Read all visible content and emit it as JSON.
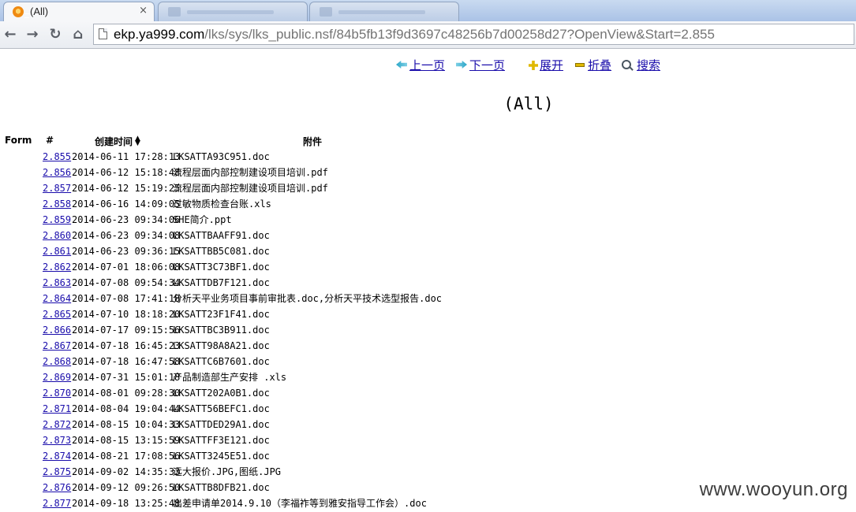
{
  "browser": {
    "tabs": [
      {
        "title": "(All)",
        "close": "×",
        "active": true
      },
      {
        "title": "",
        "active": false
      },
      {
        "title": "",
        "active": false
      }
    ],
    "nav": {
      "back": "←",
      "forward": "→",
      "reload": "↻",
      "home": "⌂"
    },
    "url": {
      "host": "ekp.ya999.com",
      "path": "/lks/sys/lks_public.nsf/84b5fb13f9d3697c48256b7d00258d27?OpenView&Start=2.855"
    }
  },
  "page": {
    "nav_links": {
      "prev": "上一页",
      "next": "下一页",
      "expand": "展开",
      "collapse": "折叠",
      "search": "搜索"
    },
    "view_title": "(All)",
    "columns": {
      "form": "Form",
      "num": "#",
      "created": "创建时间",
      "attachment": "附件"
    },
    "rows": [
      {
        "num": "2.855",
        "datetime": "2014-06-11 17:28:13",
        "file": "LKSATTA93C951.doc"
      },
      {
        "num": "2.856",
        "datetime": "2014-06-12 15:18:48",
        "file": "流程层面内部控制建设项目培训.pdf"
      },
      {
        "num": "2.857",
        "datetime": "2014-06-12 15:19:25",
        "file": "流程层面内部控制建设项目培训.pdf"
      },
      {
        "num": "2.858",
        "datetime": "2014-06-16 14:09:05",
        "file": "过敏物质检查台账.xls"
      },
      {
        "num": "2.859",
        "datetime": "2014-06-23 09:34:06",
        "file": "SHE简介.ppt"
      },
      {
        "num": "2.860",
        "datetime": "2014-06-23 09:34:08",
        "file": "LKSATTBAAFF91.doc"
      },
      {
        "num": "2.861",
        "datetime": "2014-06-23 09:36:15",
        "file": "LKSATTBB5C081.doc"
      },
      {
        "num": "2.862",
        "datetime": "2014-07-01 18:06:08",
        "file": "LKSATT3C73BF1.doc"
      },
      {
        "num": "2.863",
        "datetime": "2014-07-08 09:54:34",
        "file": "LKSATTDB7F121.doc"
      },
      {
        "num": "2.864",
        "datetime": "2014-07-08 17:41:18",
        "file": "分析天平业务项目事前审批表.doc,分析天平技术选型报告.doc"
      },
      {
        "num": "2.865",
        "datetime": "2014-07-10 18:18:20",
        "file": "LKSATT23F1F41.doc"
      },
      {
        "num": "2.866",
        "datetime": "2014-07-17 09:15:56",
        "file": "LKSATTBC3B911.doc"
      },
      {
        "num": "2.867",
        "datetime": "2014-07-18 16:45:23",
        "file": "LKSATT98A8A21.doc"
      },
      {
        "num": "2.868",
        "datetime": "2014-07-18 16:47:58",
        "file": "LKSATTC6B7601.doc"
      },
      {
        "num": "2.869",
        "datetime": "2014-07-31 15:01:18",
        "file": "产品制造部生产安排 .xls"
      },
      {
        "num": "2.870",
        "datetime": "2014-08-01 09:28:30",
        "file": "LKSATT202A0B1.doc"
      },
      {
        "num": "2.871",
        "datetime": "2014-08-04 19:04:44",
        "file": "LKSATT56BEFC1.doc"
      },
      {
        "num": "2.872",
        "datetime": "2014-08-15 10:04:33",
        "file": "LKSATTDED29A1.doc"
      },
      {
        "num": "2.873",
        "datetime": "2014-08-15 13:15:59",
        "file": "LKSATTFF3E121.doc"
      },
      {
        "num": "2.874",
        "datetime": "2014-08-21 17:08:56",
        "file": "LKSATT3245E51.doc"
      },
      {
        "num": "2.875",
        "datetime": "2014-09-02 14:35:33",
        "file": "远大报价.JPG,图纸.JPG"
      },
      {
        "num": "2.876",
        "datetime": "2014-09-12 09:26:50",
        "file": "LKSATTB8DFB21.doc"
      },
      {
        "num": "2.877",
        "datetime": "2014-09-18 13:25:48",
        "file": "出差申请单2014.9.10（李福祚等到雅安指导工作会）.doc"
      }
    ]
  },
  "watermark": "www.wooyun.org",
  "colors": {
    "link": "#1a0dab",
    "tabbar": "#aac2e6"
  }
}
